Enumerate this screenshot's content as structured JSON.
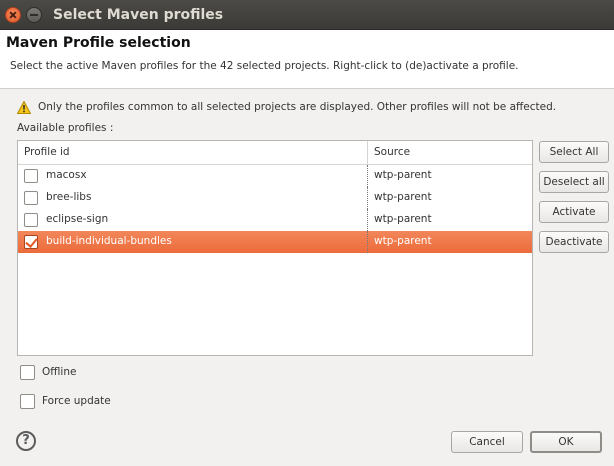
{
  "window": {
    "title": "Select Maven profiles"
  },
  "header": {
    "title": "Maven Profile selection",
    "description": "Select the active Maven profiles for the 42 selected projects. Right-click to (de)activate a profile."
  },
  "info": {
    "icon": "warning-icon",
    "text": "Only the profiles common to all selected projects are displayed. Other profiles will not be affected."
  },
  "available_label": "Available profiles :",
  "table": {
    "columns": [
      "Profile id",
      "Source"
    ],
    "rows": [
      {
        "id": "macosx",
        "source": "wtp-parent",
        "checked": false,
        "selected": false
      },
      {
        "id": "bree-libs",
        "source": "wtp-parent",
        "checked": false,
        "selected": false
      },
      {
        "id": "eclipse-sign",
        "source": "wtp-parent",
        "checked": false,
        "selected": false
      },
      {
        "id": "build-individual-bundles",
        "source": "wtp-parent",
        "checked": true,
        "selected": true
      }
    ]
  },
  "side_buttons": {
    "select_all": "Select All",
    "deselect_all": "Deselect all",
    "activate": "Activate",
    "deactivate": "Deactivate"
  },
  "options": {
    "offline": {
      "label": "Offline",
      "checked": false
    },
    "force_update": {
      "label": "Force update",
      "checked": false
    }
  },
  "footer": {
    "help": "?",
    "cancel": "Cancel",
    "ok": "OK"
  },
  "colors": {
    "selection": "#ec6b3b",
    "titlebar": "#3b3a37",
    "dialog_bg": "#f2f1f0"
  }
}
